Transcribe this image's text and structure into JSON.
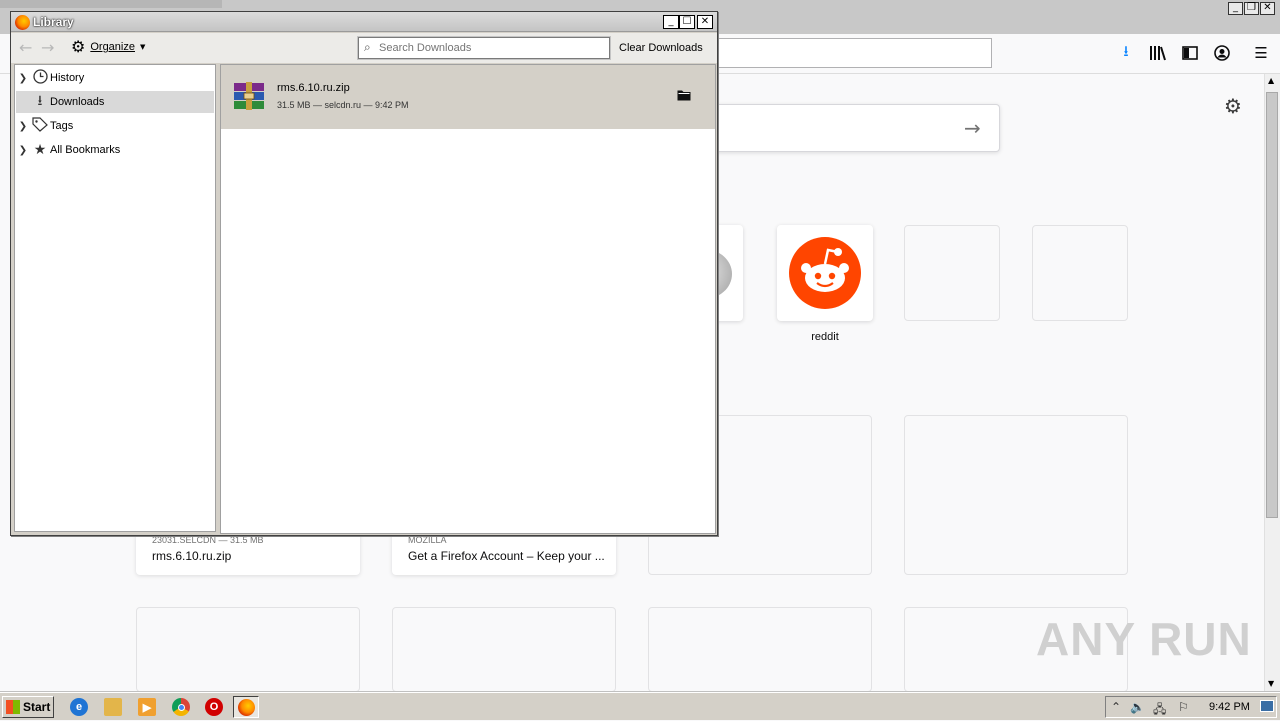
{
  "firefox": {
    "tiles": [
      {
        "label": "reddit"
      }
    ],
    "highlights": [
      {
        "meta": "23031.SELCDN — 31.5 MB",
        "title": "rms.6.10.ru.zip"
      },
      {
        "meta": "MOZILLA",
        "title": "Get a Firefox Account – Keep your ..."
      }
    ],
    "watermark": "ANY RUN"
  },
  "library": {
    "title": "Library",
    "organize_label": "Organize",
    "search_placeholder": "Search Downloads",
    "clear_label": "Clear Downloads",
    "sidebar": [
      {
        "label": "History",
        "icon": "clock-icon",
        "expandable": true
      },
      {
        "label": "Downloads",
        "icon": "download-icon",
        "expandable": false,
        "selected": true
      },
      {
        "label": "Tags",
        "icon": "tag-icon",
        "expandable": true
      },
      {
        "label": "All Bookmarks",
        "icon": "star-icon",
        "expandable": true
      }
    ],
    "download": {
      "name": "rms.6.10.ru.zip",
      "meta": "31.5 MB — selcdn.ru — 9:42 PM"
    }
  },
  "taskbar": {
    "start_label": "Start",
    "clock": "9:42 PM"
  },
  "colors": {
    "reddit": "#ff4500",
    "firefox_blue": "#0a84ff"
  }
}
